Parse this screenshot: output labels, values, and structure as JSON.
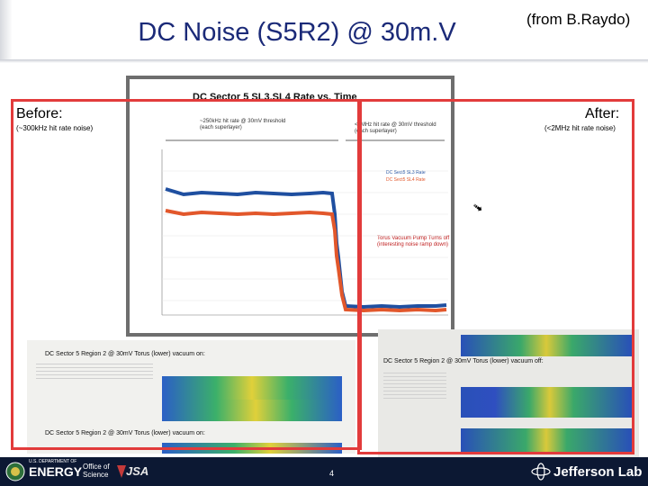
{
  "slide": {
    "title": "DC Noise (S5R2) @ 30m.V",
    "credit": "(from B.Raydo)",
    "page_number": "4"
  },
  "before": {
    "label": "Before:",
    "note": "(~300kHz hit rate noise)"
  },
  "after": {
    "label": "After:",
    "note": "(<2MHz hit rate noise)"
  },
  "plot": {
    "title": "DC Sector 5 SL3,SL4 Rate vs. Time",
    "annotation_left": "~250kHz hit rate @ 30mV threshold\n(each superlayer)",
    "annotation_right": "<2MHz hit rate @ 30mV threshold\n(each superlayer)",
    "annotation_pump": "Torus Vacuum Pump Turns off\n(interesting noise ramp down)",
    "legend": [
      "DC Sect5 SL3 Rate",
      "DC Sect5 SL4 Rate"
    ],
    "colors": {
      "sl3": "#1f4fa0",
      "sl4": "#e2572b"
    }
  },
  "screenshots": {
    "left_top_caption": "DC Sector 5 Region 2 @ 30mV Torus (lower) vacuum on:",
    "left_bottom_caption": "DC Sector 5 Region 2 @ 30mV Torus (lower) vacuum on:",
    "right_caption": "DC Sector 5 Region 2 @ 30mV Torus (lower) vacuum off:"
  },
  "footer": {
    "doe_us": "U.S. DEPARTMENT OF",
    "doe_energy": "ENERGY",
    "doe_office_1": "Office of",
    "doe_office_2": "Science",
    "jsa": "JSA",
    "jlab": "Jefferson Lab",
    "background": "#0c1833"
  },
  "colors": {
    "title": "#1b2a78",
    "frame": "#e23b3b"
  }
}
